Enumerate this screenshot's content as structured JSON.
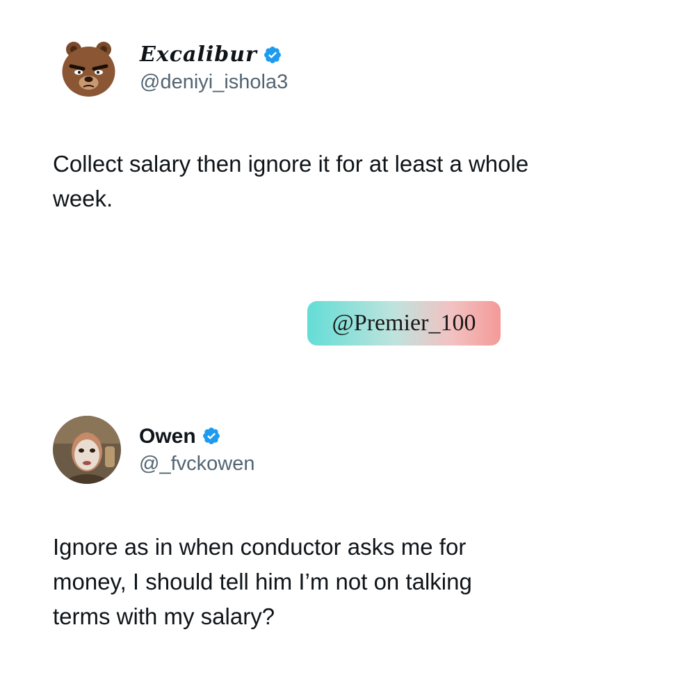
{
  "tweets": [
    {
      "display_name": "Excalibur",
      "handle": "@deniyi_ishola3",
      "verified": true,
      "avatar_icon": "cartoon-bear-avatar",
      "text": "Collect salary then ignore it for at least a whole\nweek."
    },
    {
      "display_name": "Owen",
      "handle": "@_fvckowen",
      "verified": true,
      "avatar_icon": "face-mask-photo-avatar",
      "text": "Ignore as in when conductor asks me for\nmoney, I should tell him I’m not on talking\nterms with my salary?"
    }
  ],
  "watermark": {
    "label": "@Premier_100"
  },
  "colors": {
    "text": "#0f1419",
    "handle": "#536471",
    "verified": "#1d9bf0",
    "background": "#ffffff"
  }
}
